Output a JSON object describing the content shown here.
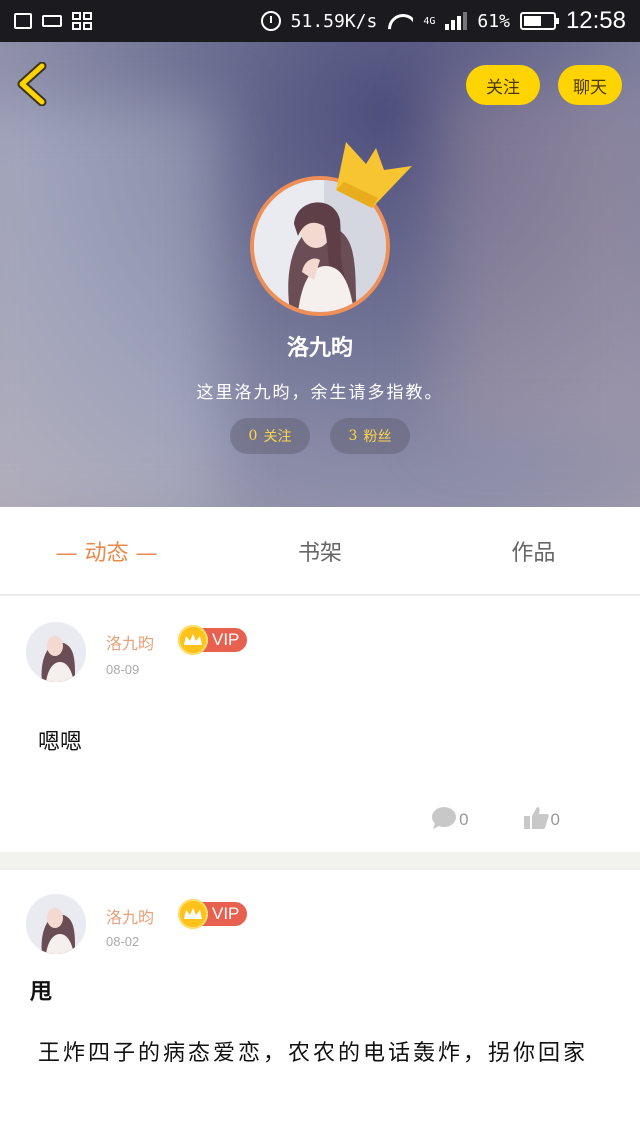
{
  "status_bar": {
    "network_speed": "51.59K/s",
    "network_type": "4G",
    "battery": "61%",
    "time": "12:58",
    "icons": [
      "image-icon",
      "box-icon",
      "grid-icon",
      "alarm-icon",
      "wifi-icon",
      "signal-icon",
      "battery-icon"
    ]
  },
  "header": {
    "follow_button": "关注",
    "chat_button": "聊天",
    "username": "洛九昀",
    "signature": "这里洛九昀，余生请多指教。",
    "following": {
      "count": "0",
      "label": "关注"
    },
    "fans": {
      "count": "3",
      "label": "粉丝"
    },
    "colors": {
      "accent": "#ffd400",
      "avatar_ring": "#ee8f57",
      "crown": "#f7c531"
    }
  },
  "tabs": [
    {
      "label": "动态",
      "active": true
    },
    {
      "label": "书架",
      "active": false
    },
    {
      "label": "作品",
      "active": false
    }
  ],
  "posts": [
    {
      "author": "洛九昀",
      "vip": "VIP",
      "date": "08-09",
      "text": "嗯嗯",
      "comments": "0",
      "likes": "0"
    },
    {
      "author": "洛九昀",
      "vip": "VIP",
      "date": "08-02",
      "title": "甩",
      "body": "王炸四子的病态爱恋，农农的电话轰炸，拐你回家"
    }
  ],
  "colors": {
    "tab_active": "#e78a4b",
    "vip_tag": "#e8604f",
    "vip_crown": "#ffc21a"
  }
}
